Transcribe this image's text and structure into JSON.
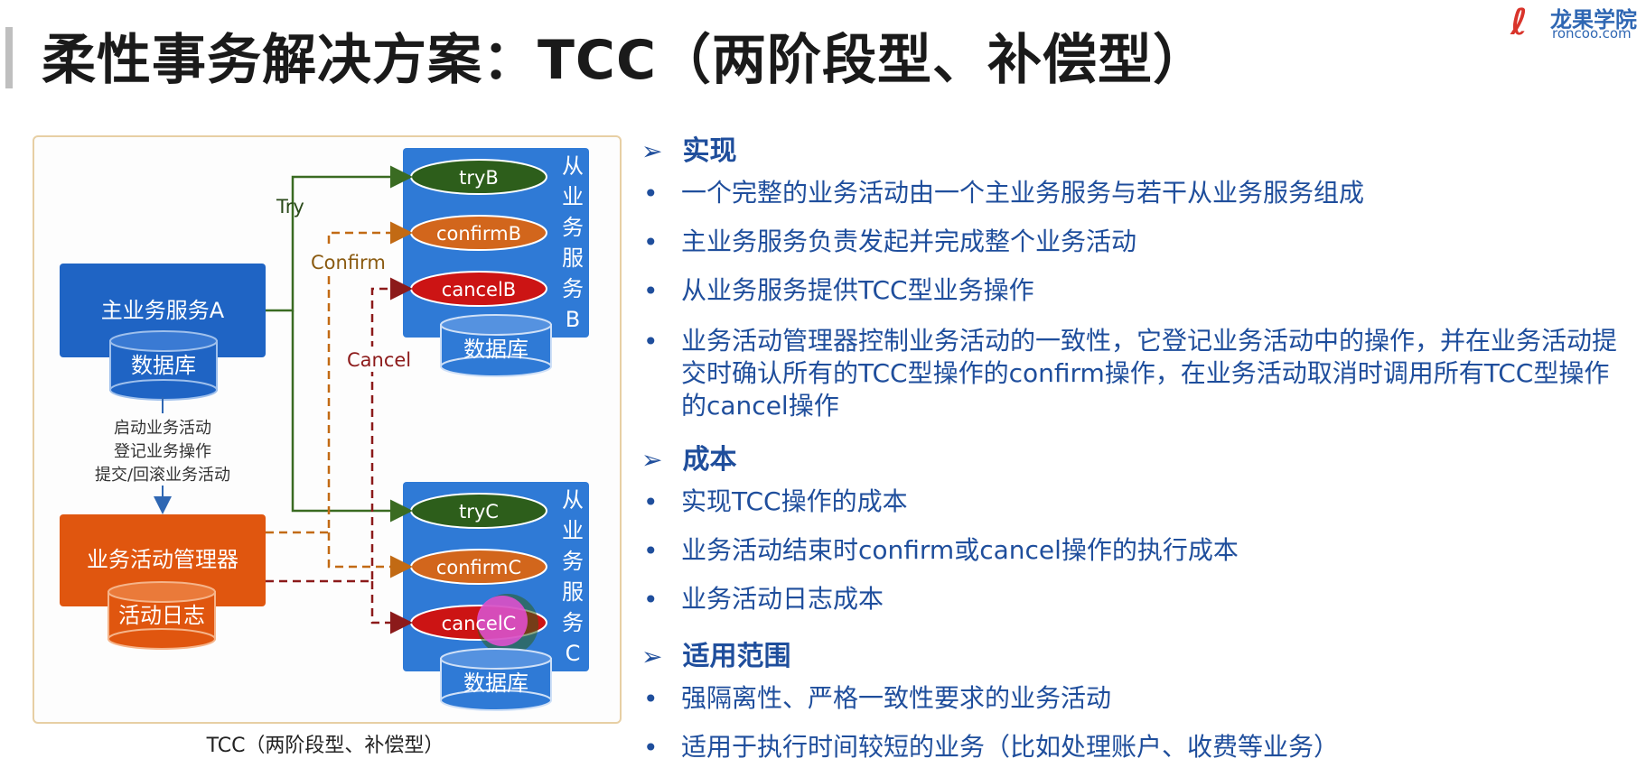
{
  "title": "柔性事务解决方案：TCC（两阶段型、补偿型）",
  "logo": {
    "cn": "龙果学院",
    "en": "roncoo.com"
  },
  "diagram": {
    "main_service": "主业务服务A",
    "main_db": "数据库",
    "manager": "业务活动管理器",
    "manager_log": "活动日志",
    "notes": [
      "启动业务活动",
      "登记业务操作",
      "提交/回滚业务活动"
    ],
    "labels": {
      "try": "Try",
      "confirm": "Confirm",
      "cancel": "Cancel"
    },
    "service_b": {
      "side": [
        "从",
        "业",
        "务",
        "服",
        "务",
        "B"
      ],
      "try": "tryB",
      "confirm": "confirmB",
      "cancel": "cancelB",
      "db": "数据库"
    },
    "service_c": {
      "side": [
        "从",
        "业",
        "务",
        "服",
        "务",
        "C"
      ],
      "try": "tryC",
      "confirm": "confirmC",
      "cancel": "cancelC",
      "db": "数据库"
    },
    "caption": "TCC（两阶段型、补偿型）"
  },
  "sections": [
    {
      "head": "实现",
      "items": [
        "一个完整的业务活动由一个主业务服务与若干从业务服务组成",
        "主业务服务负责发起并完成整个业务活动",
        "从业务服务提供TCC型业务操作",
        "业务活动管理器控制业务活动的一致性，它登记业务活动中的操作，并在业务活动提交时确认所有的TCC型操作的confirm操作，在业务活动取消时调用所有TCC型操作的cancel操作"
      ]
    },
    {
      "head": "成本",
      "items": [
        "实现TCC操作的成本",
        "业务活动结束时confirm或cancel操作的执行成本",
        "业务活动日志成本"
      ]
    },
    {
      "head": "适用范围",
      "items": [
        "强隔离性、严格一致性要求的业务活动",
        "适用于执行时间较短的业务（比如处理账户、收费等业务）"
      ]
    }
  ],
  "colors": {
    "blue": "#1f64c4",
    "orange": "#e0560f",
    "try_oval": "#2d5e1b",
    "confirm_oval": "#d2661c",
    "cancel_oval": "#cc1414",
    "text_blue": "#1f4e9c",
    "try_line": "#3a6b22",
    "confirm_line": "#c26a14",
    "cancel_line": "#8c1a1a"
  }
}
